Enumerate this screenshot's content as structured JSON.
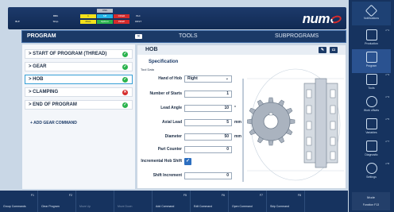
{
  "status_bar": {
    "cells": [
      {
        "label": "ONb",
        "color": "#b9bec8"
      },
      {
        "label": "BBK",
        "color": "#8c95a3"
      },
      {
        "label": "1",
        "color": "#f3e11a"
      },
      {
        "label": "SPI",
        "color": "#22b3e6"
      },
      {
        "label": "CDGR",
        "color": "#d52b2b"
      },
      {
        "label": "PLC",
        "color": "#8c95a3"
      },
      {
        "label": "BLE",
        "color": "#8c95a3"
      },
      {
        "label": "Stop",
        "color": "#8c95a3"
      },
      {
        "label": "MAG",
        "color": "#f3e11a"
      },
      {
        "label": "Option",
        "color": "#2ab34d"
      },
      {
        "label": "PRGE",
        "color": "#d52b2b"
      },
      {
        "label": "ORST",
        "color": "#8c95a3"
      }
    ],
    "logo": "num"
  },
  "tabs": {
    "program": "PROGRAM",
    "tools": "TOOLS",
    "subprograms": "SUBPROGRAMS"
  },
  "commands": [
    {
      "label": "> START OF PROGRAM (THREAD)",
      "status": "ok",
      "status_color": "#2ab34d"
    },
    {
      "label": "> GEAR",
      "status": "ok",
      "status_color": "#2ab34d"
    },
    {
      "label": "> HOB",
      "status": "ok",
      "status_color": "#2ab34d",
      "selected": true
    },
    {
      "label": "> CLAMPING",
      "status": "error",
      "status_color": "#d52b2b"
    },
    {
      "label": "> END OF PROGRAM",
      "status": "ok",
      "status_color": "#2ab34d"
    }
  ],
  "add_command": "+ ADD GEAR COMMAND",
  "detail": {
    "title": "HOB",
    "subtitle": "Specification",
    "tool_data": "Tool Data",
    "hand_of_hob_label": "Hand of Hob",
    "hand_of_hob_value": "Right",
    "number_of_starts_label": "Number of Starts",
    "number_of_starts_value": "1",
    "lead_angle_label": "Lead Angle",
    "lead_angle_value": "10",
    "lead_angle_unit": "°",
    "axial_lead_label": "Axial Lead",
    "axial_lead_value": "5",
    "axial_lead_unit": "mm",
    "diameter_label": "Diameter",
    "diameter_value": "50",
    "diameter_unit": "mm",
    "part_counter_label": "Part Counter",
    "part_counter_value": "0",
    "incremental_hob_shift_label": "Incremental Hob Shift",
    "shift_increment_label": "Shift Increment",
    "shift_increment_value": "0"
  },
  "sidebar": {
    "notifications": "Notifications",
    "items": [
      {
        "label": "Production",
        "num": "n°1"
      },
      {
        "label": "Program",
        "num": ""
      },
      {
        "label": "Tools",
        "num": "n°3"
      },
      {
        "label": "Work offsets",
        "num": "n°4"
      },
      {
        "label": "Variables",
        "num": "n°5"
      },
      {
        "label": "Diagnostic",
        "num": "n°7"
      },
      {
        "label": "Settings",
        "num": "n°8"
      }
    ],
    "mode": "Mode",
    "function": "Function F13"
  },
  "bottom": [
    {
      "key": "F1",
      "label": "Group Commands",
      "dim": false
    },
    {
      "key": "F2",
      "label": "Clear Program",
      "dim": false
    },
    {
      "key": "",
      "label": "Move Up",
      "dim": true
    },
    {
      "key": "",
      "label": "Move Down",
      "dim": true
    },
    {
      "key": "F5",
      "label": "Add Command",
      "dim": false
    },
    {
      "key": "F6",
      "label": "Edit Command",
      "dim": false
    },
    {
      "key": "F7",
      "label": "Open Command",
      "dim": false
    },
    {
      "key": "F8",
      "label": "Skip Command",
      "dim": false
    }
  ]
}
